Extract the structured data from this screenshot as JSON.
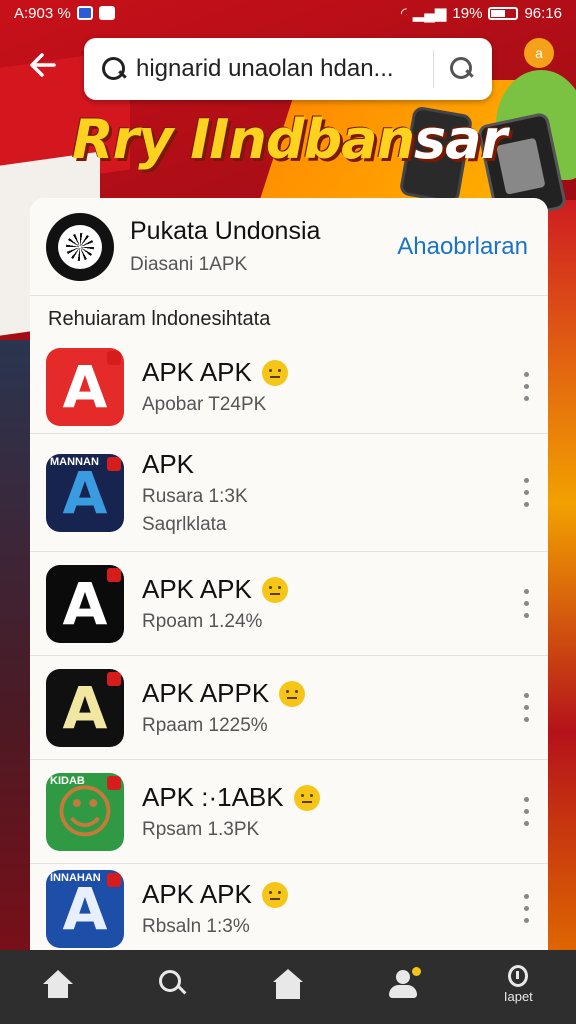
{
  "status_bar": {
    "left_text": "A:903 %",
    "battery": "19%",
    "time": "96:16"
  },
  "topbar": {
    "back_icon": "arrow-left-icon",
    "search_text": "hignarid unaolan hdan...",
    "badge": "a"
  },
  "banner": {
    "line_a": "Rry IIndban",
    "line_b": "sar"
  },
  "header": {
    "title": "Pukata Undonsia",
    "subtitle": "Diasani 1APK",
    "action": "Ahaobrlaran"
  },
  "section_title": "Rehuiaram lndonesihtata",
  "apps": [
    {
      "name": "APK APK",
      "line1": "Apobar T24PK",
      "line2": "",
      "emoji": true,
      "bg": "#e52a2a",
      "fg": "#ffffff",
      "glyph": "A",
      "tag": ""
    },
    {
      "name": "APK",
      "line1": "Rusara 1:3K",
      "line2": "Saqrlklata",
      "emoji": false,
      "bg": "#17244f",
      "fg": "#3a9be0",
      "glyph": "A",
      "tag": "MANNAN"
    },
    {
      "name": "APK APK",
      "line1": "Rpoam 1.24%",
      "line2": "",
      "emoji": true,
      "bg": "#0b0b0b",
      "fg": "#ffffff",
      "glyph": "A",
      "tag": ""
    },
    {
      "name": "APK APPK",
      "line1": "Rpaam 1225%",
      "line2": "",
      "emoji": true,
      "bg": "#101010",
      "fg": "#f2e7a1",
      "glyph": "A",
      "tag": ""
    },
    {
      "name": "APK :·1ABK",
      "line1": "Rpsam 1.3PK",
      "line2": "",
      "emoji": true,
      "bg": "#2f9a43",
      "fg": "#c47a3a",
      "glyph": "☺",
      "tag": "KIDAB"
    },
    {
      "name": "APK APK",
      "line1": "Rbsaln 1:3%",
      "line2": "",
      "emoji": true,
      "bg": "#1d4ea8",
      "fg": "#e8f0ff",
      "glyph": "A",
      "tag": "INNAHAN"
    }
  ],
  "nav": {
    "items": [
      {
        "icon": "home-icon",
        "label": ""
      },
      {
        "icon": "search-icon",
        "label": ""
      },
      {
        "icon": "store-icon",
        "label": ""
      },
      {
        "icon": "profile-icon",
        "label": ""
      },
      {
        "icon": "lapet-icon",
        "label": "Iapet"
      }
    ]
  }
}
